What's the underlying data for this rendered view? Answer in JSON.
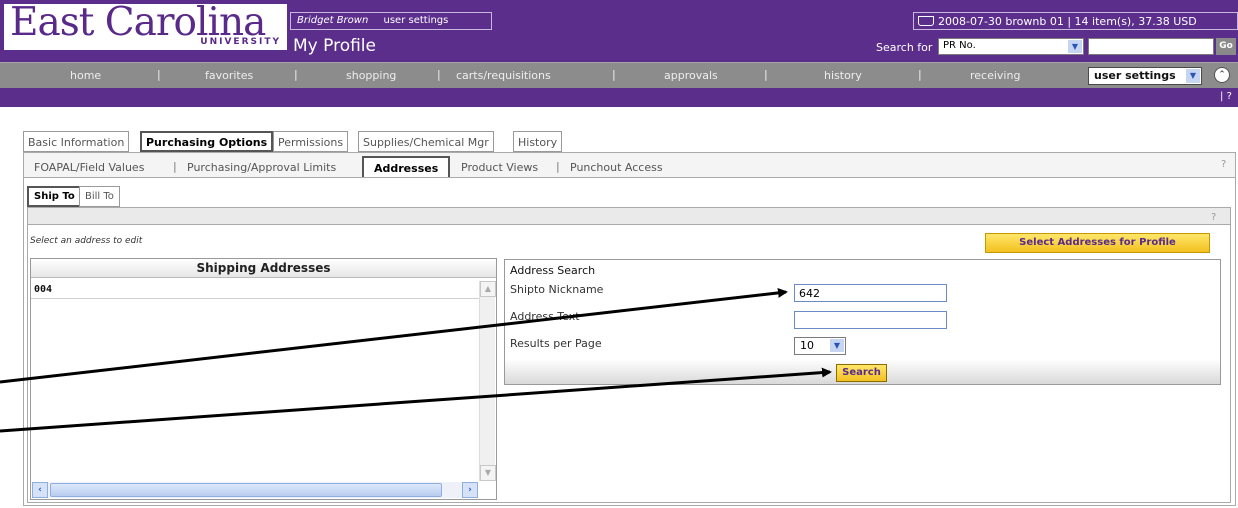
{
  "header": {
    "logo_main": "East Carolina",
    "logo_sub": "UNIVERSITY",
    "user_name": "Bridget Brown",
    "user_settings_link": "user settings",
    "page_title": "My Profile",
    "cart_summary": "2008-07-30 brownb 01 | 14 item(s), 37.38 USD",
    "search_label": "Search for",
    "search_type": "PR No.",
    "search_value": "",
    "go_label": "Go"
  },
  "nav": {
    "items": [
      "home",
      "favorites",
      "shopping",
      "carts/requisitions",
      "approvals",
      "history",
      "receiving"
    ],
    "selected": "user settings",
    "help": "?"
  },
  "tabs": [
    "Basic Information",
    "Purchasing Options",
    "Permissions",
    "Supplies/Chemical Mgr",
    "History"
  ],
  "subtabs": [
    "FOAPAL/Field Values",
    "Purchasing/Approval Limits",
    "Addresses",
    "Product Views",
    "Punchout Access"
  ],
  "inner_tabs": [
    "Ship To",
    "Bill To"
  ],
  "help_mark": "?",
  "hint": "Select an address to edit",
  "select_button": "Select Addresses for Profile",
  "shipping": {
    "title": "Shipping Addresses",
    "items": [
      "004"
    ]
  },
  "address_search": {
    "title": "Address Search",
    "nickname_label": "Shipto Nickname",
    "nickname_value": "642",
    "address_text_label": "Address Text",
    "address_text_value": "",
    "results_label": "Results per Page",
    "results_value": "10",
    "search_button": "Search"
  },
  "colors": {
    "brand_purple": "#5b2e8c",
    "nav_gray": "#8c8c8c",
    "button_yellow": "#f3c120"
  }
}
